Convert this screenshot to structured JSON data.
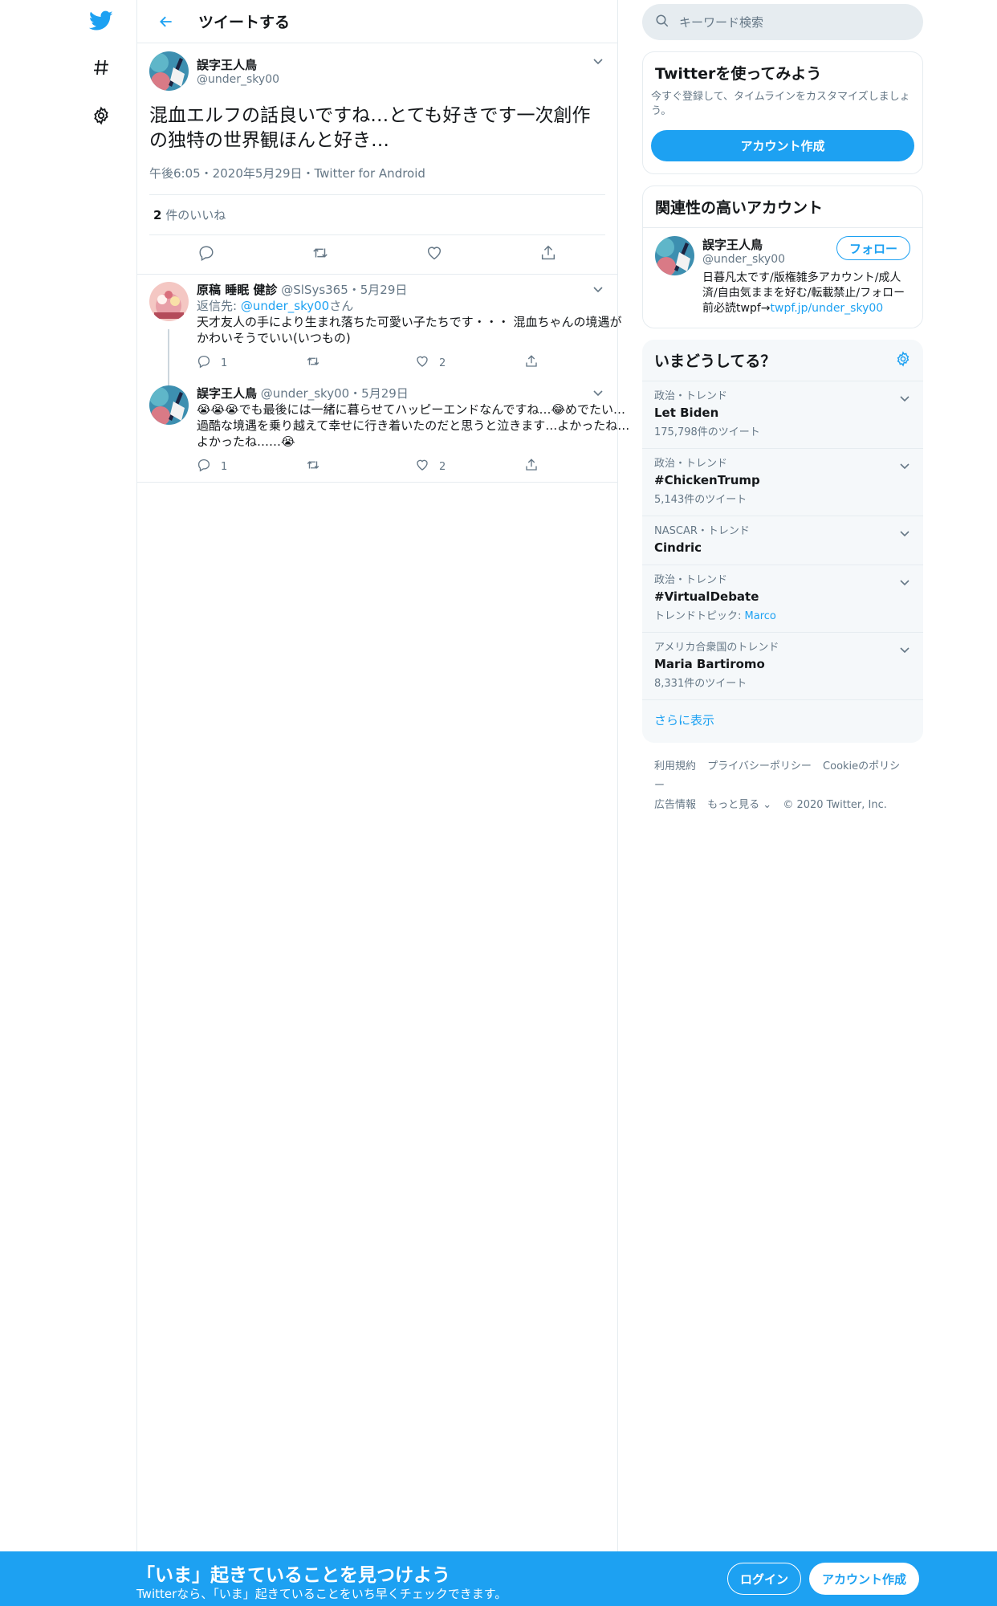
{
  "colors": {
    "accent": "#1da1f2",
    "border": "#e6ecf0",
    "secondary_text": "#657786"
  },
  "header": {
    "title": "ツイートする"
  },
  "main_tweet": {
    "name": "誤字王人鳥",
    "handle": "@under_sky00",
    "text": "混血エルフの話良いですね…とても好きです一次創作の独特の世界観ほんと好き…",
    "meta": "午後6:05・2020年5月29日・Twitter for Android",
    "likes_count": "2",
    "likes_label": " 件のいいね"
  },
  "replies": [
    {
      "name": "原稿 睡眠 健診",
      "handle": "@SlSys365・5月29日",
      "reply_to_prefix": "返信先: ",
      "reply_to_handle": "@under_sky00",
      "reply_to_suffix": "さん",
      "text": "天才友人の手により生まれ落ちた可愛い子たちです・・・ 混血ちゃんの境遇がかわいそうでいい(いつもの)",
      "reply_count": "1",
      "like_count": "2"
    },
    {
      "name": "誤字王人鳥",
      "handle": "@under_sky00・5月29日",
      "text": "😭😭😭でも最後には一緒に暮らせてハッピーエンドなんですね…😂めでたい…過酷な境遇を乗り越えて幸せに行き着いたのだと思うと泣きます…よかったね…よかったね……😭",
      "reply_count": "1",
      "like_count": "2"
    }
  ],
  "search": {
    "placeholder": "キーワード検索"
  },
  "signup_card": {
    "title": "Twitterを使ってみよう",
    "subtitle": "今すぐ登録して、タイムラインをカスタマイズしましょう。",
    "button": "アカウント作成"
  },
  "related": {
    "title": "関連性の高いアカウント",
    "name": "誤字王人鳥",
    "handle": "@under_sky00",
    "follow": "フォロー",
    "bio": "日暮凡太です/版権雑多アカウント/成人済/自由気ままを好む/転載禁止/フォロー前必読twpf→",
    "bio_link": "twpf.jp/under_sky00"
  },
  "trends": {
    "title": "いまどうしてる？",
    "items": [
      {
        "meta": "政治・トレンド",
        "name": "Let Biden",
        "count": "175,798件のツイート"
      },
      {
        "meta": "政治・トレンド",
        "name": "#ChickenTrump",
        "count": "5,143件のツイート"
      },
      {
        "meta": "NASCAR・トレンド",
        "name": "Cindric",
        "count": ""
      },
      {
        "meta": "政治・トレンド",
        "name": "#VirtualDebate",
        "topic_label": "トレンドトピック: ",
        "topic": "Marco"
      },
      {
        "meta": "アメリカ合衆国のトレンド",
        "name": "Maria Bartiromo",
        "count": "8,331件のツイート"
      }
    ],
    "more": "さらに表示"
  },
  "footer": {
    "links": [
      "利用規約",
      "プライバシーポリシー",
      "Cookieのポリシー",
      "広告情報",
      "もっと見る ⌄",
      "© 2020 Twitter, Inc."
    ]
  },
  "bottom_bar": {
    "title": "「いま」起きていることを見つけよう",
    "subtitle": "Twitterなら、「いま」起きていることをいち早くチェックできます。",
    "login": "ログイン",
    "signup": "アカウント作成"
  }
}
